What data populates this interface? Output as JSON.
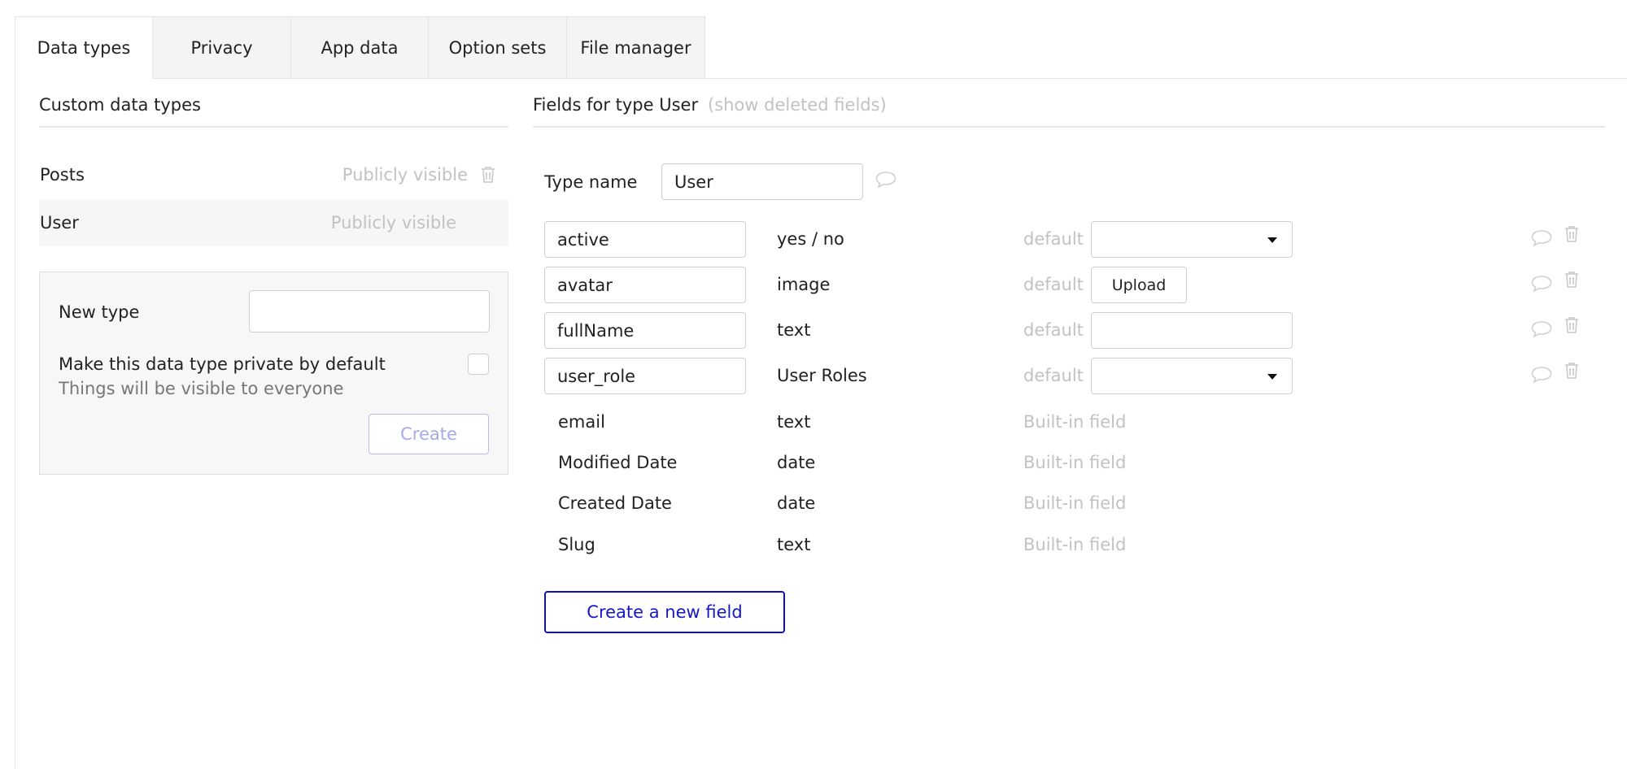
{
  "tabs": [
    {
      "label": "Data types",
      "active": true
    },
    {
      "label": "Privacy",
      "active": false
    },
    {
      "label": "App data",
      "active": false
    },
    {
      "label": "Option sets",
      "active": false
    },
    {
      "label": "File manager",
      "active": false
    }
  ],
  "left": {
    "title": "Custom data types",
    "types": [
      {
        "name": "Posts",
        "visibility": "Publicly visible"
      },
      {
        "name": "User",
        "visibility": "Publicly visible"
      }
    ],
    "new_type": {
      "label": "New type",
      "value": "",
      "private_label": "Make this data type private by default",
      "private_hint": "Things will be visible to everyone",
      "create_label": "Create"
    }
  },
  "right": {
    "title": "Fields for type User",
    "show_deleted": "(show deleted fields)",
    "type_name_label": "Type name",
    "type_name_value": "User",
    "default_label": "default",
    "custom_fields": [
      {
        "name": "active",
        "type": "yes / no",
        "default_control": "select"
      },
      {
        "name": "avatar",
        "type": "image",
        "default_control": "upload",
        "upload_label": "Upload"
      },
      {
        "name": "fullName",
        "type": "text",
        "default_control": "text"
      },
      {
        "name": "user_role",
        "type": "User Roles",
        "default_control": "select"
      }
    ],
    "builtin_fields": [
      {
        "name": "email",
        "type": "text",
        "note": "Built-in field"
      },
      {
        "name": "Modified Date",
        "type": "date",
        "note": "Built-in field"
      },
      {
        "name": "Created Date",
        "type": "date",
        "note": "Built-in field"
      },
      {
        "name": "Slug",
        "type": "text",
        "note": "Built-in field"
      }
    ],
    "create_field_label": "Create a new field"
  },
  "colors": {
    "accent": "#1418c8",
    "muted": "#c2c2c2",
    "panel": "#f7f7f7"
  }
}
